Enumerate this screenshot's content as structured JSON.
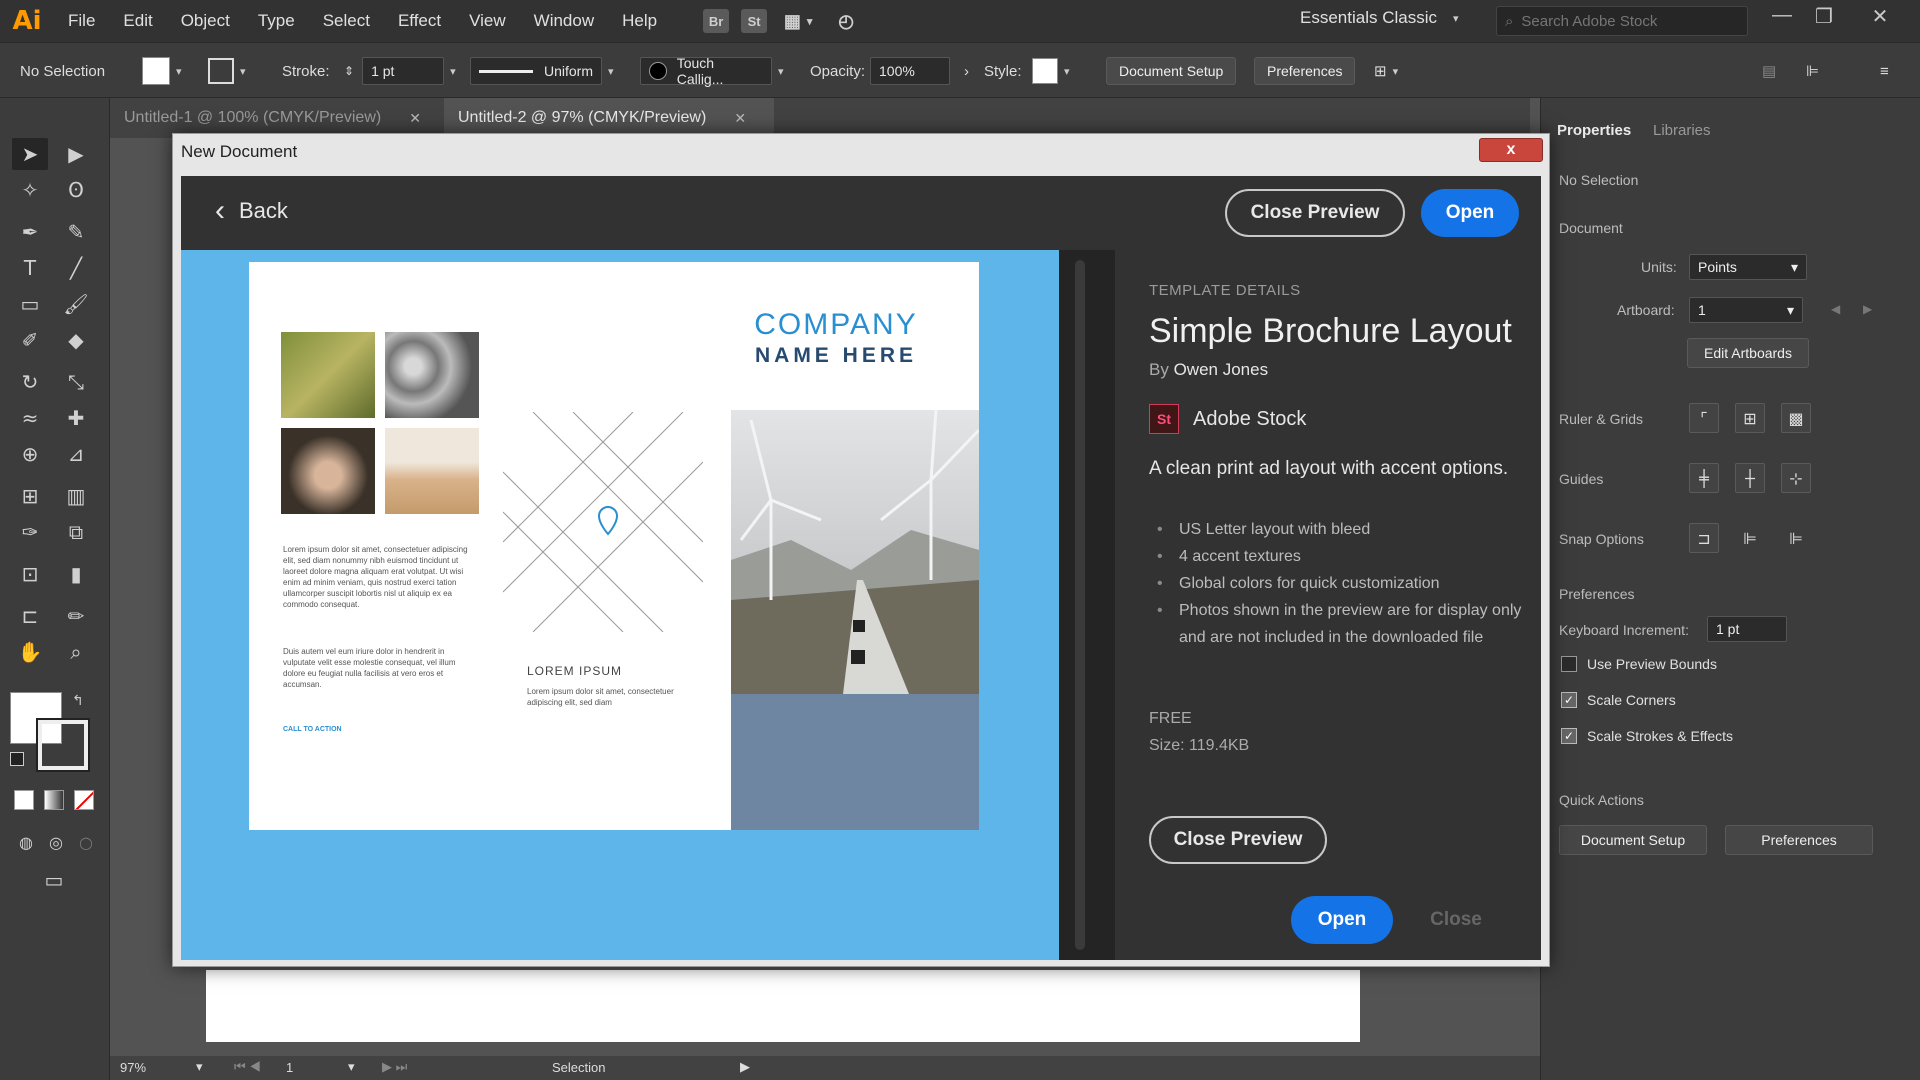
{
  "app": {
    "logo": "Ai"
  },
  "menu": [
    "File",
    "Edit",
    "Object",
    "Type",
    "Select",
    "Effect",
    "View",
    "Window",
    "Help"
  ],
  "menubar_icons": {
    "bridge": "Br",
    "stock": "St"
  },
  "workspace": "Essentials Classic",
  "stock_search": {
    "placeholder": "Search Adobe Stock"
  },
  "controlbar": {
    "selection": "No Selection",
    "stroke_label": "Stroke:",
    "stroke_value": "1 pt",
    "profile": "Uniform",
    "brush": "Touch Callig...",
    "opacity_label": "Opacity:",
    "opacity_value": "100%",
    "style_label": "Style:",
    "document_setup": "Document Setup",
    "preferences": "Preferences"
  },
  "tabs": [
    {
      "label": "Untitled-1 @ 100% (CMYK/Preview)",
      "active": false
    },
    {
      "label": "Untitled-2 @ 97% (CMYK/Preview)",
      "active": true
    }
  ],
  "dialog": {
    "title": "New Document",
    "close_glyph": "x",
    "back": "Back",
    "close_preview": "Close Preview",
    "open": "Open",
    "close": "Close"
  },
  "brochure": {
    "company_line1": "COMPANY",
    "company_line2": "NAME HERE",
    "section_heading": "LOREM IPSUM",
    "body1": "Lorem ipsum dolor sit amet, consectetuer adipiscing elit, sed diam nonummy nibh euismod tincidunt ut laoreet dolore magna aliquam erat volutpat. Ut wisi enim ad minim veniam, quis nostrud exerci tation ullamcorper suscipit lobortis nisl ut aliquip ex ea commodo consequat.",
    "body2": "Duis autem vel eum iriure dolor in hendrerit in vulputate velit esse molestie consequat, vel illum dolore eu feugiat nulla facilisis at vero eros et accumsan.",
    "body3": "Lorem ipsum dolor sit amet, consectetuer adipiscing elit, sed diam",
    "cta": "CALL TO ACTION",
    "accent_color": "#2a8fd0"
  },
  "template": {
    "eyebrow": "TEMPLATE DETAILS",
    "name": "Simple Brochure Layout",
    "by": "By",
    "author": "Owen Jones",
    "source_badge": "St",
    "source": "Adobe Stock",
    "description": "A clean print ad layout with accent options.",
    "features": [
      "US Letter layout with bleed",
      "4 accent textures",
      "Global colors for quick customization",
      "Photos shown in the preview are for display only and are not included in the downloaded file"
    ],
    "price": "FREE",
    "size": "Size: 119.4KB"
  },
  "properties_panel": {
    "tabs": [
      "Properties",
      "Libraries"
    ],
    "selection": "No Selection",
    "document_heading": "Document",
    "units_label": "Units:",
    "units_value": "Points",
    "artboard_label": "Artboard:",
    "artboard_value": "1",
    "edit_artboards": "Edit Artboards",
    "ruler_grids": "Ruler & Grids",
    "guides": "Guides",
    "snap_options": "Snap Options",
    "preferences_heading": "Preferences",
    "keyboard_increment_label": "Keyboard Increment:",
    "keyboard_increment_value": "1 pt",
    "use_preview_bounds": "Use Preview Bounds",
    "scale_corners": "Scale Corners",
    "scale_strokes": "Scale Strokes & Effects",
    "quick_actions": "Quick Actions",
    "document_setup": "Document Setup",
    "preferences": "Preferences"
  },
  "statusbar": {
    "zoom": "97%",
    "artboard": "1",
    "tool": "Selection"
  }
}
